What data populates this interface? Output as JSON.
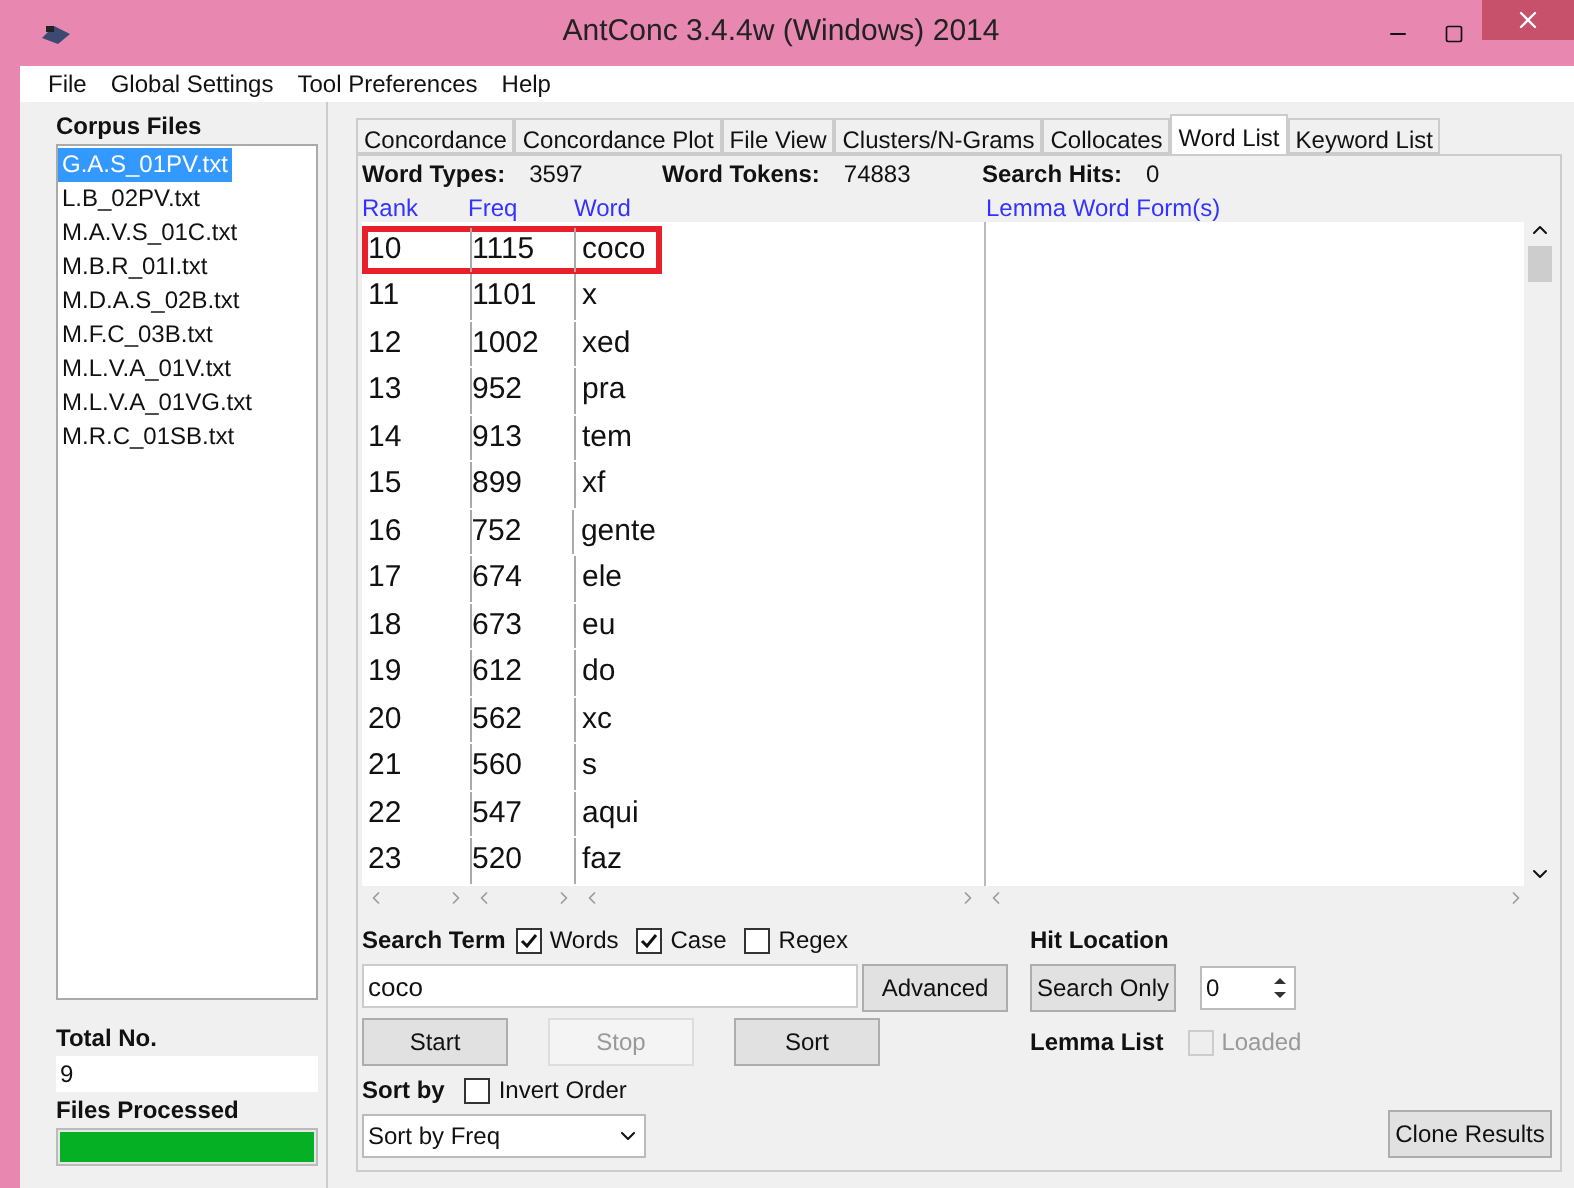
{
  "window": {
    "title": "AntConc 3.4.4w (Windows) 2014"
  },
  "menu": [
    "File",
    "Global Settings",
    "Tool Preferences",
    "Help"
  ],
  "corpus": {
    "title": "Corpus Files",
    "files": [
      {
        "name": "G.A.S_01PV.txt",
        "selected": true
      },
      {
        "name": "L.B_02PV.txt",
        "selected": false
      },
      {
        "name": "M.A.V.S_01C.txt",
        "selected": false
      },
      {
        "name": "M.B.R_01I.txt",
        "selected": false
      },
      {
        "name": "M.D.A.S_02B.txt",
        "selected": false
      },
      {
        "name": "M.F.C_03B.txt",
        "selected": false
      },
      {
        "name": "M.L.V.A_01V.txt",
        "selected": false
      },
      {
        "name": "M.L.V.A_01VG.txt",
        "selected": false
      },
      {
        "name": "M.R.C_01SB.txt",
        "selected": false
      }
    ],
    "total_label": "Total No.",
    "total": "9",
    "processed_label": "Files Processed",
    "processed": {
      "level": 1
    }
  },
  "tabs": [
    {
      "label": "Concordance",
      "selected": false
    },
    {
      "label": "Concordance Plot",
      "selected": false
    },
    {
      "label": "File View",
      "selected": false
    },
    {
      "label": "Clusters/N-Grams",
      "selected": false
    },
    {
      "label": "Collocates",
      "selected": false
    },
    {
      "label": "Word List",
      "selected": true
    },
    {
      "label": "Keyword List",
      "selected": false
    }
  ],
  "stats": [
    {
      "label": "Word Types:",
      "value": "3597"
    },
    {
      "label": "Word Tokens:",
      "value": "74883"
    },
    {
      "label": "Search Hits:",
      "value": "0"
    }
  ],
  "table": {
    "columns": [
      "Rank",
      "Freq",
      "Word"
    ],
    "rows": [
      {
        "cells": [
          "10",
          "1115",
          "coco"
        ],
        "highlighted": true
      },
      {
        "cells": [
          "11",
          "1101",
          "x"
        ],
        "highlighted": false
      },
      {
        "cells": [
          "12",
          "1002",
          "xed"
        ],
        "highlighted": false
      },
      {
        "cells": [
          "13",
          "952",
          "pra"
        ],
        "highlighted": false
      },
      {
        "cells": [
          "14",
          "913",
          "tem"
        ],
        "highlighted": false
      },
      {
        "cells": [
          "15",
          "899",
          "xf"
        ],
        "highlighted": false
      },
      {
        "cells": [
          "16",
          "752",
          "gente"
        ],
        "highlighted": false
      },
      {
        "cells": [
          "17",
          "674",
          "ele"
        ],
        "highlighted": false
      },
      {
        "cells": [
          "18",
          "673",
          "eu"
        ],
        "highlighted": false
      },
      {
        "cells": [
          "19",
          "612",
          "do"
        ],
        "highlighted": false
      },
      {
        "cells": [
          "20",
          "562",
          "xc"
        ],
        "highlighted": false
      },
      {
        "cells": [
          "21",
          "560",
          "s"
        ],
        "highlighted": false
      },
      {
        "cells": [
          "22",
          "547",
          "aqui"
        ],
        "highlighted": false
      },
      {
        "cells": [
          "23",
          "520",
          "faz"
        ],
        "highlighted": false
      }
    ]
  },
  "lemma": {
    "title": "Lemma Word Form(s)"
  },
  "search": {
    "label": "Search Term",
    "options": [
      {
        "label": "Words",
        "checked": true
      },
      {
        "label": "Case",
        "checked": true
      },
      {
        "label": "Regex",
        "checked": false
      }
    ],
    "value": "coco",
    "advanced": "Advanced"
  },
  "actions": [
    {
      "label": "Start",
      "disabled": false
    },
    {
      "label": "Stop",
      "disabled": true
    },
    {
      "label": "Sort",
      "disabled": false
    }
  ],
  "sort": {
    "label": "Sort by",
    "invert": {
      "label": "Invert Order",
      "checked": false
    },
    "value": "Sort by Freq"
  },
  "hit": {
    "label": "Hit Location",
    "button": "Search Only",
    "value": "0"
  },
  "lemma_list": {
    "label": "Lemma List",
    "loaded": {
      "label": "Loaded",
      "checked": false,
      "disabled": true
    }
  },
  "clone": "Clone Results"
}
